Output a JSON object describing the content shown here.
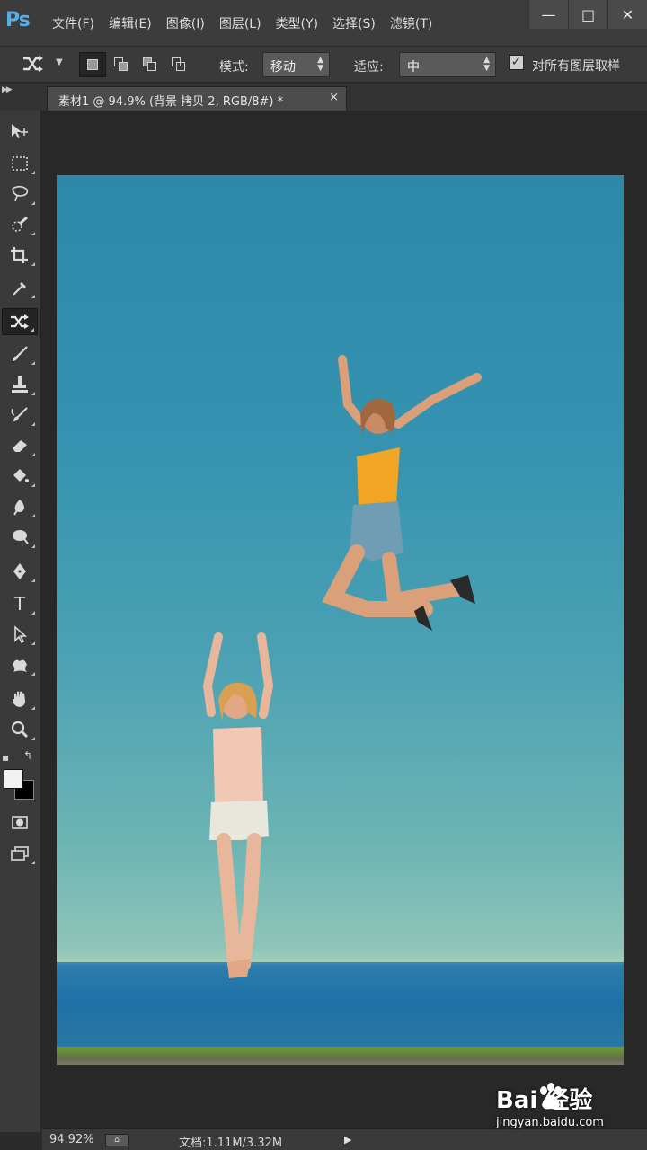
{
  "app": {
    "logo": "Ps",
    "menu": [
      "文件(F)",
      "编辑(E)",
      "图像(I)",
      "图层(L)",
      "类型(Y)",
      "选择(S)",
      "滤镜(T)"
    ],
    "window_buttons": {
      "minimize": "—",
      "maximize": "□",
      "close": "✕"
    }
  },
  "options": {
    "tool_icon": "content-aware-move-icon",
    "mode_label": "模式:",
    "mode_value": "移动",
    "adapt_label": "适应:",
    "adapt_value": "中",
    "sample_all_checked": true,
    "sample_all_label": "对所有图层取样"
  },
  "document_tab": {
    "title": "素材1 @ 94.9% (背景 拷贝 2, RGB/8#) *",
    "close": "×"
  },
  "toolbar": {
    "tools": [
      "move-tool-icon",
      "rectangular-marquee-icon",
      "lasso-icon",
      "quick-selection-icon",
      "crop-icon",
      "eyedropper-icon",
      "content-aware-move-icon",
      "brush-icon",
      "clone-stamp-icon",
      "history-brush-icon",
      "eraser-icon",
      "paint-bucket-icon",
      "blur-icon",
      "dodge-icon",
      "pen-icon",
      "type-icon",
      "path-selection-icon",
      "custom-shape-icon",
      "hand-icon",
      "zoom-icon"
    ],
    "active_tool": "content-aware-move-icon",
    "foreground_color": "#f2f2f2",
    "background_color": "#000000"
  },
  "status": {
    "zoom": "94.92%",
    "doc_info": "文档:1.11M/3.32M",
    "arrow": "▶"
  },
  "watermark": {
    "logo_text": "Bai  经验",
    "url": "jingyan.baidu.com"
  }
}
